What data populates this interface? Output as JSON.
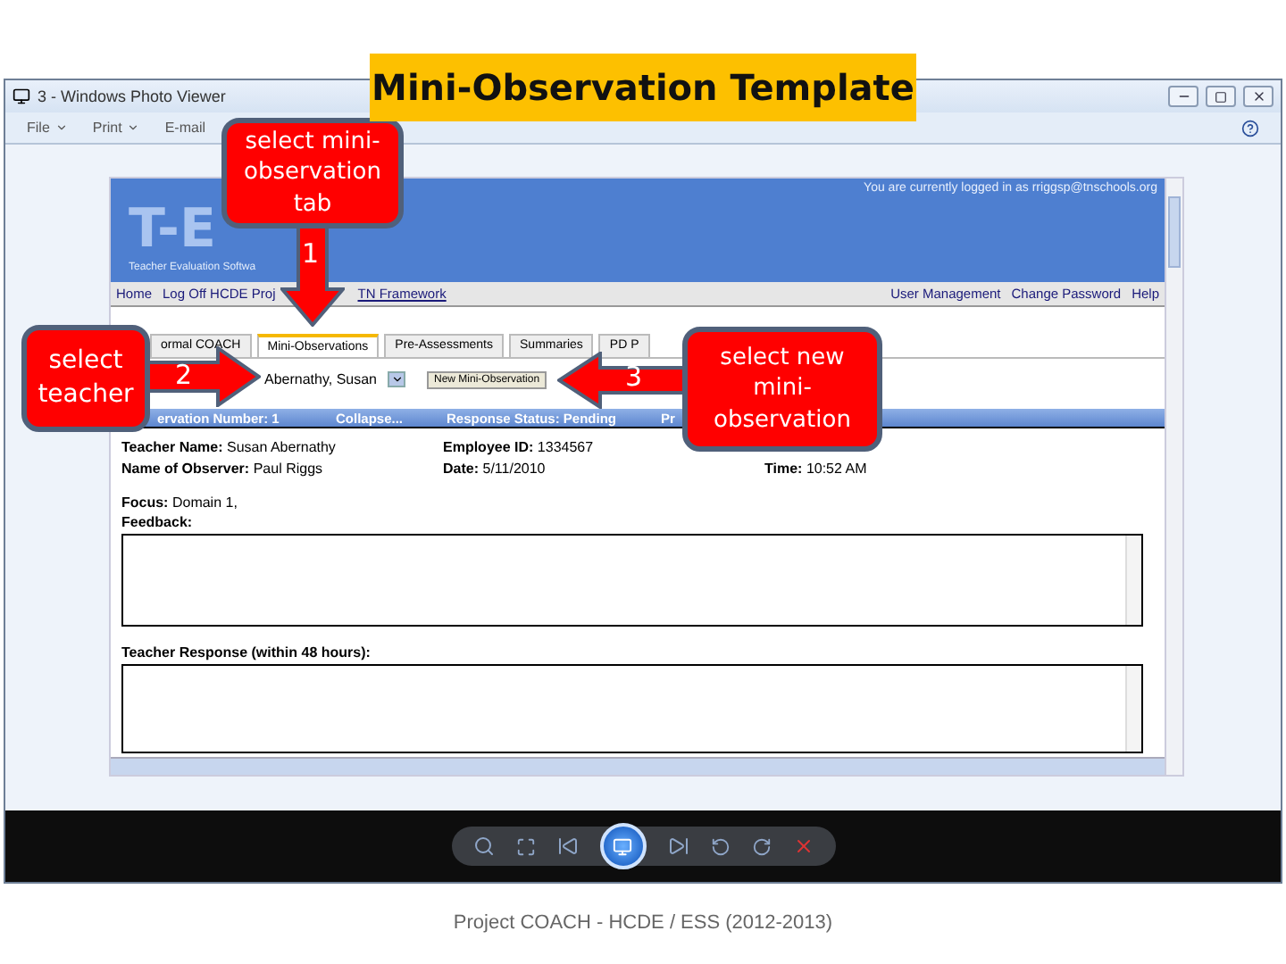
{
  "slide_title": "Mini-Observation Template",
  "viewer": {
    "title": "3 - Windows Photo Viewer",
    "menu": [
      {
        "label": "File",
        "dropdown": true
      },
      {
        "label": "Print",
        "dropdown": true
      },
      {
        "label": "E-mail",
        "dropdown": false
      }
    ]
  },
  "web_page": {
    "logo": "T-E",
    "tagline": "Teacher Evaluation Softwa",
    "login_text": "You are currently logged in as rriggsp@tnschools.org",
    "nav_left": [
      {
        "label": "Home",
        "underlined": false
      },
      {
        "label": "Log Off HCDE Proj",
        "underlined": false
      },
      {
        "label": "TN Framework",
        "underlined": true
      }
    ],
    "nav_right": [
      "User Management",
      "Change Password",
      "Help"
    ],
    "tabs": [
      {
        "label": "ormal COACH",
        "selected": false
      },
      {
        "label": "Mini-Observations",
        "selected": true
      },
      {
        "label": "Pre-Assessments",
        "selected": false
      },
      {
        "label": "Summaries",
        "selected": false
      },
      {
        "label": "PD P",
        "selected": false
      }
    ],
    "teacher_select": "Abernathy, Susan",
    "new_button": "New Mini-Observation",
    "header_bar": [
      "ervation Number: 1",
      "Collapse...",
      "Response Status: Pending",
      "Pr"
    ],
    "details": [
      [
        {
          "label": "Teacher Name:",
          "value": "Susan Abernathy"
        },
        {
          "label": "Employee ID:",
          "value": "1334567"
        }
      ],
      [
        {
          "label": "Name of Observer:",
          "value": "Paul Riggs"
        },
        {
          "label": "Date:",
          "value": "5/11/2010"
        },
        {
          "label": "Time:",
          "value": "10:52 AM"
        }
      ]
    ],
    "focus_label": "Focus:",
    "focus_value": "Domain 1,",
    "feedback_label": "Feedback:",
    "response_label": "Teacher Response (within 48 hours):"
  },
  "callouts": [
    {
      "text": "select mini-observation tab",
      "number": "1"
    },
    {
      "text": "select teacher",
      "number": "2"
    },
    {
      "text": "select new mini-observation",
      "number": "3"
    }
  ],
  "footer": "Project COACH - HCDE / ESS (2012-2013)"
}
